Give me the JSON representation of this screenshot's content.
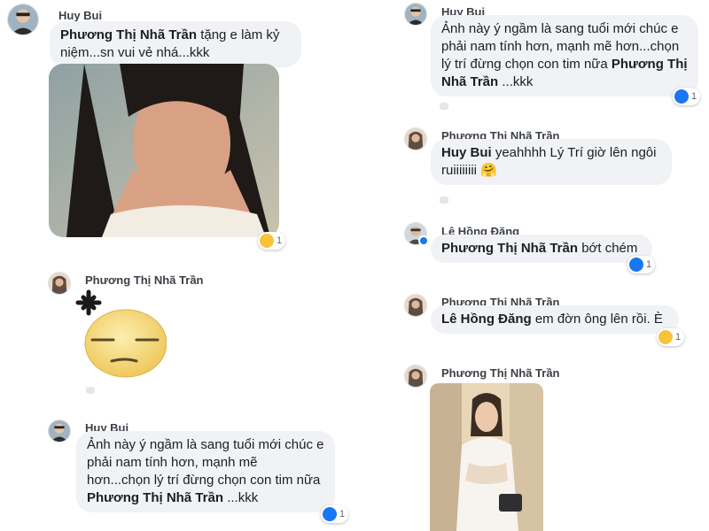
{
  "left": {
    "c1": {
      "author": "Huy Bui",
      "mention": "Phương Thị Nhã Trần",
      "text": " tặng e làm kỷ niệm...sn vui vẻ nhá...kkk",
      "reaction_count": "1"
    },
    "c2": {
      "author": "Phương Thị Nhã Trần"
    },
    "c3": {
      "author": "Huy Bui",
      "text": "Ảnh này ý ngầm là sang tuổi mới chúc e phải nam tính hơn, mạnh mẽ hơn...chọn lý trí đừng chọn con tim nữa ",
      "mention": "Phương Thị Nhã Trần",
      "suffix": " ...kkk",
      "reaction_count": "1"
    }
  },
  "right": {
    "c1": {
      "author": "Huy Bui",
      "text": "Ảnh này ý ngầm là sang tuổi mới chúc e phải nam tính hơn, mạnh mẽ hơn...chọn lý trí đừng chọn con tim nữa ",
      "mention": "Phương Thị Nhã Trần",
      "suffix": " ...kkk",
      "reaction_count": "1"
    },
    "c2": {
      "author": "Phương Thị Nhã Trần",
      "mention": "Huy Bui",
      "text": "  yeahhhh  Lý Trí giờ lên ngôi ruiiiiiiii ",
      "emoji": "🤗"
    },
    "c3": {
      "author": "Lê Hồng Đăng",
      "mention": "Phương Thị Nhã Trần",
      "text": " bớt chém",
      "reaction_count": "1"
    },
    "c4": {
      "author": "Phương Thị Nhã Trần",
      "mention": "Lê Hồng Đăng",
      "text": "  em đờn ông lên rồi. È",
      "reaction_count": "1"
    },
    "c5": {
      "author": "Phương Thị Nhã Trần"
    }
  },
  "colors": {
    "bubble": "#f0f2f5",
    "like": "#1877f2",
    "haha": "#f7c439"
  }
}
